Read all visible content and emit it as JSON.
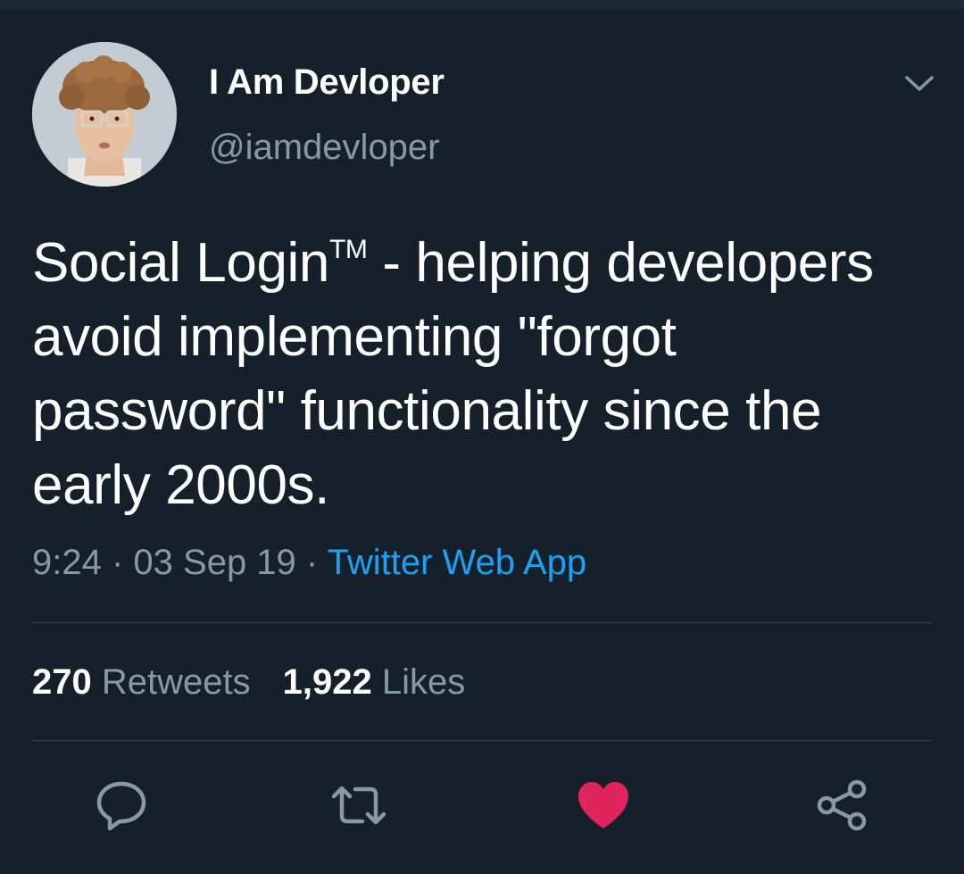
{
  "author": {
    "display_name": "I Am Devloper",
    "handle": "@iamdevloper"
  },
  "tweet": {
    "line1_a": "Social Login",
    "line1_tm": "TM",
    "line1_b": " - helping developers",
    "line2": "avoid implementing \"forgot",
    "line3": "password\" functionality since the",
    "line4": "early 2000s."
  },
  "meta": {
    "time": "9:24",
    "sep1": " · ",
    "date": "03 Sep 19",
    "sep2": " · ",
    "source": "Twitter Web App"
  },
  "stats": {
    "retweets_count": "270",
    "retweets_label": "Retweets",
    "likes_count": "1,922",
    "likes_label": "Likes"
  },
  "actions": {
    "reply_icon": "reply-icon",
    "retweet_icon": "retweet-icon",
    "like_icon": "heart-icon",
    "share_icon": "share-icon",
    "liked": true,
    "like_color": "#e0245e"
  },
  "colors": {
    "background": "#15202b",
    "muted": "#8899a6",
    "link": "#1da1f2",
    "divider": "#38444d"
  }
}
